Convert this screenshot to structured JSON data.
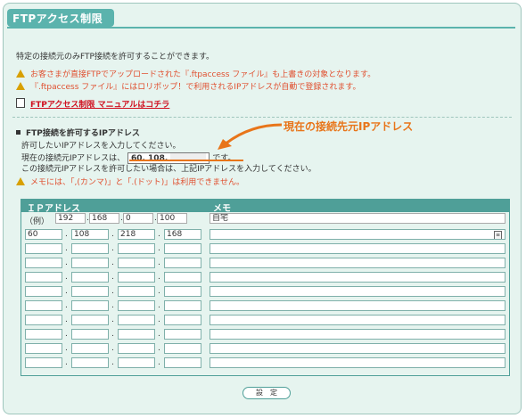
{
  "title": "FTPアクセス制限",
  "intro": "特定の接続元のみFTP接続を許可することができます。",
  "warnings": [
    "お客さまが直接FTPでアップロードされた『.ftpaccess ファイル』も上書きの対象となります。",
    "『.ftpaccess ファイル』にはロリポップ！で利用されるIPアドレスが自動で登録されます。"
  ],
  "manual_link": "FTPアクセス制限 マニュアルはコチラ",
  "callout": "現在の接続先元IPアドレス",
  "section_title": "FTP接続を許可するIPアドレス",
  "instructions": {
    "line1": "許可したいIPアドレスを入力してください。",
    "line2_prefix": "現在の接続元IPアドレスは、",
    "current_ip": "60. 108.",
    "line2_suffix": "です。",
    "line3": "この接続元IPアドレスを許可したい場合は、上記IPアドレスを入力してください。"
  },
  "memo_warning": "メモには、「,(カンマ)」と「.(ドット)」は利用できません。",
  "table": {
    "header_ip": "ＩＰアドレス",
    "header_memo": "メモ",
    "example_label": "（例）",
    "example": {
      "ip": [
        "192",
        "168",
        "0",
        "100"
      ],
      "memo": "自宅"
    },
    "rows": [
      {
        "ip": [
          "60",
          "108",
          "218",
          "168"
        ],
        "memo": ""
      },
      {
        "ip": [
          "",
          "",
          "",
          ""
        ],
        "memo": ""
      },
      {
        "ip": [
          "",
          "",
          "",
          ""
        ],
        "memo": ""
      },
      {
        "ip": [
          "",
          "",
          "",
          ""
        ],
        "memo": ""
      },
      {
        "ip": [
          "",
          "",
          "",
          ""
        ],
        "memo": ""
      },
      {
        "ip": [
          "",
          "",
          "",
          ""
        ],
        "memo": ""
      },
      {
        "ip": [
          "",
          "",
          "",
          ""
        ],
        "memo": ""
      },
      {
        "ip": [
          "",
          "",
          "",
          ""
        ],
        "memo": ""
      },
      {
        "ip": [
          "",
          "",
          "",
          ""
        ],
        "memo": ""
      },
      {
        "ip": [
          "",
          "",
          "",
          ""
        ],
        "memo": ""
      }
    ]
  },
  "set_button": "設　定",
  "colors": {
    "accent": "#4f9f98",
    "warning_text": "#e05030",
    "callout": "#e8751a",
    "link": "#d01020"
  }
}
